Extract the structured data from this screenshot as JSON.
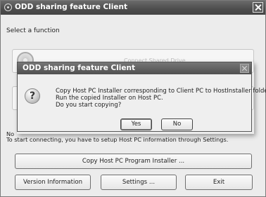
{
  "window": {
    "title": "ODD sharing feature Client"
  },
  "main": {
    "select_label": "Select a function",
    "function1_label": "Connect Shared Drive",
    "note_line1": "No",
    "note_line2": "To start connecting, you have to setup Host PC information through Settings."
  },
  "buttons": {
    "copy_installer": "Copy Host PC Program Installer ...",
    "version_info": "Version Information",
    "settings": "Settings ...",
    "exit": "Exit"
  },
  "dialog": {
    "title": "ODD sharing feature Client",
    "message_line1": "Copy Host PC Installer corresponding to Client PC to HostInstaller folder.",
    "message_line2": "Run the copied Installer on Host PC.",
    "message_line3": "Do you start copying?",
    "yes_label": "Yes",
    "no_label": "No",
    "icon": "question-icon"
  }
}
